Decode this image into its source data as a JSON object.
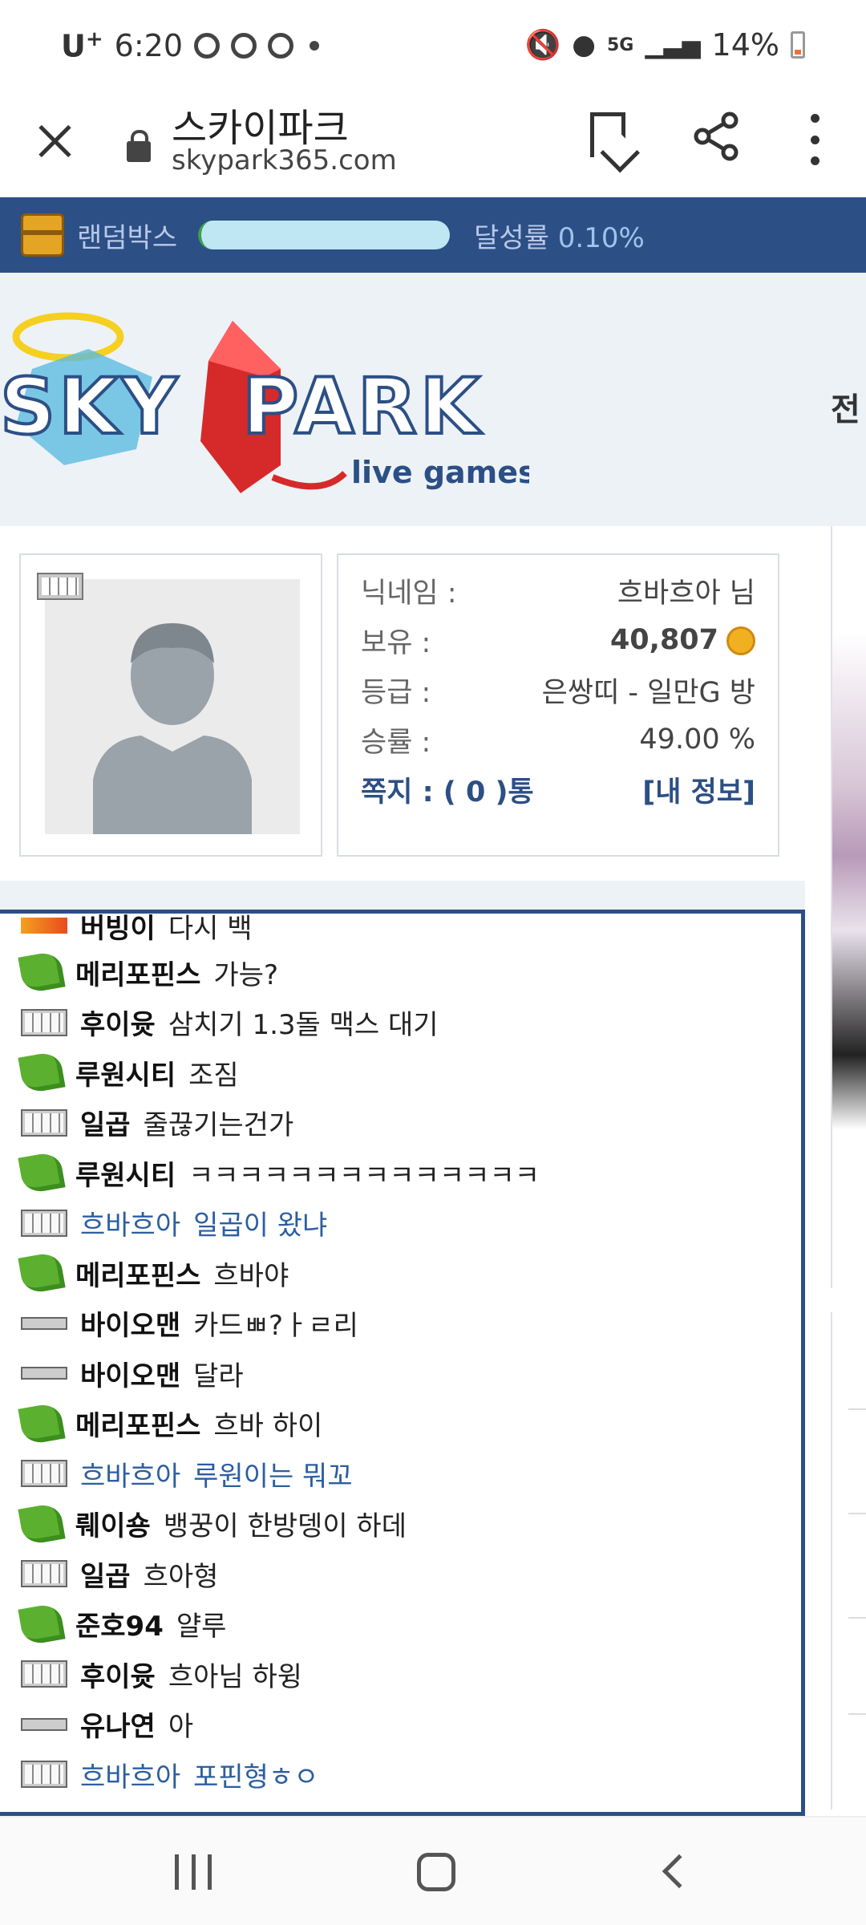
{
  "status_bar": {
    "carrier": "U",
    "carrier_sup": "+",
    "time": "6:20",
    "network": "5G",
    "battery": "14%"
  },
  "browser": {
    "title": "스카이파크",
    "url": "skypark365.com"
  },
  "random_box": {
    "label": "랜덤박스",
    "rate_label": "달성률",
    "rate_value": "0.10%",
    "progress": 0.001
  },
  "logo": {
    "word1": "SKY",
    "word2": "PARK",
    "tagline": "live games",
    "side_text": "전"
  },
  "profile": {
    "nickname_label": "닉네임 :",
    "nickname_value": "흐바흐아 님",
    "balance_label": "보유 :",
    "balance_value": "40,807",
    "grade_label": "등급 :",
    "grade_value": "은쌍띠 - 일만G 방",
    "winrate_label": "승률 :",
    "winrate_value": "49.00 %",
    "message_link": "쪽지 : ( 0 )통",
    "myinfo_link": "[내 정보]"
  },
  "chat": {
    "partial_top": {
      "user": "버빙이",
      "msg": "다시 백"
    },
    "messages": [
      {
        "icon": "leaf",
        "user": "메리포핀스",
        "msg": "가능?"
      },
      {
        "icon": "bar",
        "user": "후이윳",
        "msg": "삼치기 1.3돌 맥스 대기"
      },
      {
        "icon": "leaf",
        "user": "루원시티",
        "msg": "조짐"
      },
      {
        "icon": "bar",
        "user": "일곱",
        "msg": "줄끊기는건가"
      },
      {
        "icon": "leaf",
        "user": "루원시티",
        "msg": "ㅋㅋㅋㅋㅋㅋㅋㅋㅋㅋㅋㅋㅋㅋ"
      },
      {
        "icon": "bar",
        "user": "흐바흐아",
        "msg": "일곱이 왔냐",
        "self": true
      },
      {
        "icon": "leaf",
        "user": "메리포핀스",
        "msg": "흐바야"
      },
      {
        "icon": "thin",
        "user": "바이오맨",
        "msg": "카드ㅃ?ㅏㄹ리"
      },
      {
        "icon": "thin",
        "user": "바이오맨",
        "msg": "달라"
      },
      {
        "icon": "leaf",
        "user": "메리포핀스",
        "msg": "흐바 하이"
      },
      {
        "icon": "bar",
        "user": "흐바흐아",
        "msg": "루원이는 뭐꼬",
        "self": true
      },
      {
        "icon": "leaf",
        "user": "뤠이숑",
        "msg": "뱅꿍이 한방뎅이 하데"
      },
      {
        "icon": "bar",
        "user": "일곱",
        "msg": "흐아형"
      },
      {
        "icon": "leaf",
        "user": "준호94",
        "msg": "얄루"
      },
      {
        "icon": "bar",
        "user": "후이윳",
        "msg": "흐아님 하윙"
      },
      {
        "icon": "thin",
        "user": "유나연",
        "msg": "아"
      },
      {
        "icon": "bar",
        "user": "흐바흐아",
        "msg": "포핀형ㅎㅇ",
        "self": true
      }
    ]
  }
}
